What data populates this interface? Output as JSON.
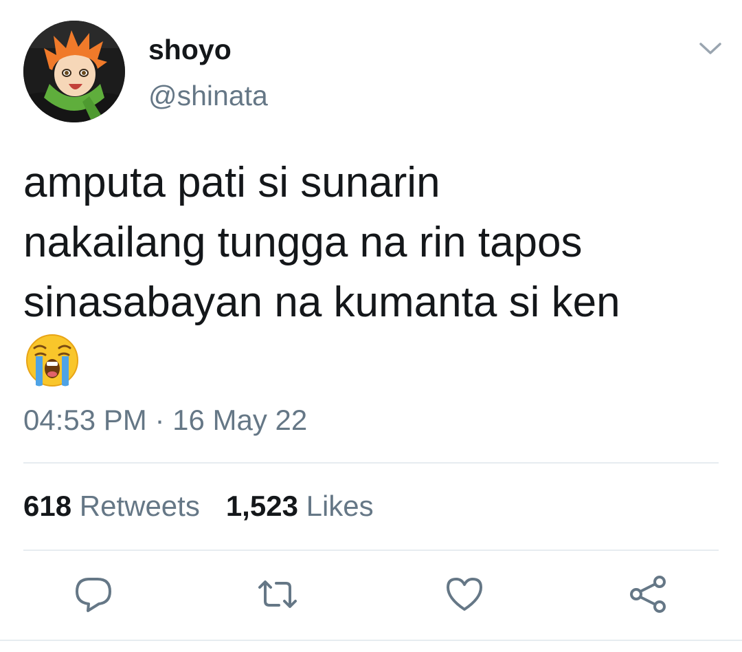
{
  "author": {
    "display_name": "shoyo",
    "handle": "@shinata",
    "avatar_icon": "profile-avatar"
  },
  "tweet": {
    "text": "amputa pati si sunarin\nnakailang tungga na rin tapos\nsinasabayan na kumanta si ken",
    "emoji": "loudly-crying-face",
    "timestamp": "04:53 PM · 16 May 22"
  },
  "stats": {
    "retweets_count": "618",
    "retweets_label": "Retweets",
    "likes_count": "1,523",
    "likes_label": "Likes"
  },
  "actions": {
    "reply_icon": "reply-icon",
    "retweet_icon": "retweet-icon",
    "like_icon": "heart-icon",
    "share_icon": "share-icon"
  },
  "colors": {
    "primary_text": "#14171a",
    "secondary_text": "#657786",
    "divider": "#e6ecf0",
    "icon": "#657786"
  }
}
